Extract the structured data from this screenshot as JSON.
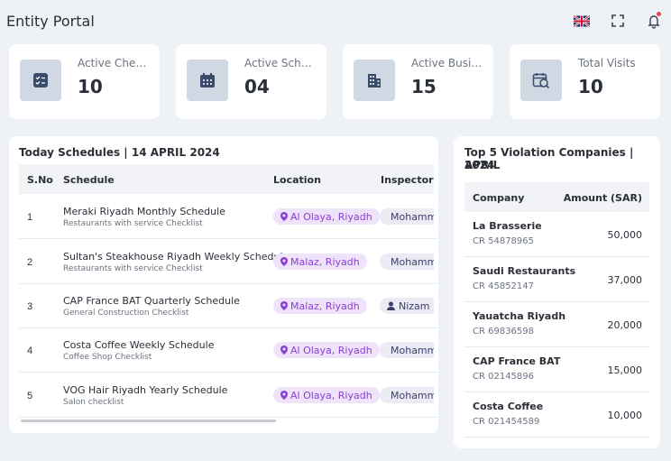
{
  "app": {
    "title": "Entity Portal"
  },
  "header": {
    "icons": [
      "uk-flag-icon",
      "fullscreen-icon",
      "bell-icon"
    ],
    "notification_color": "#e5484d"
  },
  "stats": [
    {
      "label": "Active Checkl...",
      "value": "10",
      "icon": "checklist-icon"
    },
    {
      "label": "Active Sched...",
      "value": "04",
      "icon": "calendar-icon"
    },
    {
      "label": "Active Busine...",
      "value": "15",
      "icon": "building-icon"
    },
    {
      "label": "Total Visits",
      "value": "10",
      "icon": "calendar-check-icon"
    }
  ],
  "schedules": {
    "title": "Today Schedules | 14 APRIL 2024",
    "columns": {
      "sno": "S.No",
      "schedule": "Schedule",
      "location": "Location",
      "inspector": "Inspector"
    },
    "rows": [
      {
        "sno": "1",
        "name": "Meraki Riyadh Monthly Schedule",
        "checklist": "Restaurants with service Checklist",
        "location": "Al Olaya, Riyadh",
        "inspector": "Mohammed"
      },
      {
        "sno": "2",
        "name": "Sultan's Steakhouse Riyadh Weekly Schedule",
        "checklist": "Restaurants with service Checklist",
        "location": "Malaz, Riyadh",
        "inspector": "Mohammed"
      },
      {
        "sno": "3",
        "name": "CAP France BAT Quarterly Schedule",
        "checklist": "General Construction Checklist",
        "location": "Malaz, Riyadh",
        "inspector": "Nizam"
      },
      {
        "sno": "4",
        "name": "Costa Coffee Weekly Schedule",
        "checklist": "Coffee Shop Checklist",
        "location": "Al Olaya, Riyadh",
        "inspector": "Mohammed"
      },
      {
        "sno": "5",
        "name": "VOG Hair Riyadh Yearly Schedule",
        "checklist": "Salon checklist",
        "location": "Al Olaya, Riyadh",
        "inspector": "Mohammed"
      }
    ]
  },
  "violations": {
    "title_line1": "Top 5 Violation Companies | APRIL",
    "title_line2": "2024",
    "columns": {
      "company": "Company",
      "amount": "Amount (SAR)"
    },
    "rows": [
      {
        "company": "La Brasserie",
        "cr": "CR 54878965",
        "amount": "50,000"
      },
      {
        "company": "Saudi Restaurants",
        "cr": "CR 45852147",
        "amount": "37,000"
      },
      {
        "company": "Yauatcha Riyadh",
        "cr": "CR 69836598",
        "amount": "20,000"
      },
      {
        "company": "CAP France BAT",
        "cr": "CR 02145896",
        "amount": "15,000"
      },
      {
        "company": "Costa Coffee",
        "cr": "CR 021454589",
        "amount": "10,000"
      }
    ]
  },
  "colors": {
    "location_pill_bg": "#efe3fb",
    "location_pill_text": "#8a3fd1",
    "inspector_pill_bg": "#ecebf3",
    "icon_tile": "#cfd8e3"
  }
}
